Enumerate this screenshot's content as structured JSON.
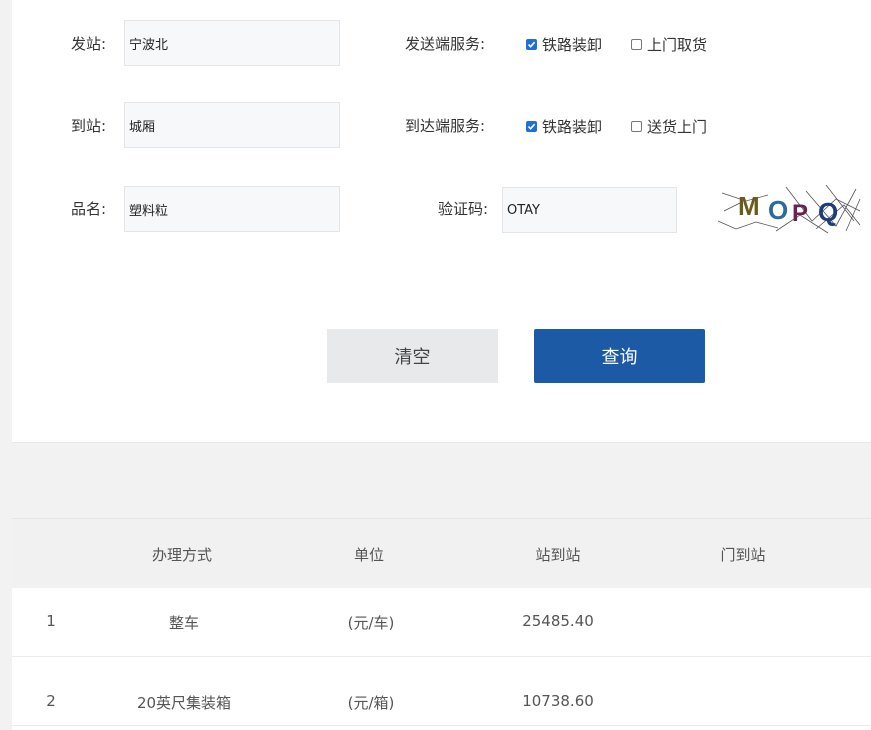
{
  "form": {
    "origin_label": "发站:",
    "origin_value": "宁波北",
    "dest_label": "到站:",
    "dest_value": "城厢",
    "goods_label": "品名:",
    "goods_value": "塑料粒",
    "send_service_label": "发送端服务:",
    "send_rail_label": "铁路装卸",
    "send_rail_checked": true,
    "send_pickup_label": "上门取货",
    "send_pickup_checked": false,
    "arrive_service_label": "到达端服务:",
    "arrive_rail_label": "铁路装卸",
    "arrive_rail_checked": true,
    "arrive_delivery_label": "送货上门",
    "arrive_delivery_checked": false,
    "captcha_label": "验证码:",
    "captcha_value": "OTAY",
    "captcha_image_text": "MOPQ"
  },
  "buttons": {
    "clear_label": "清空",
    "query_label": "查询"
  },
  "table": {
    "headers": [
      "办理方式",
      "单位",
      "站到站",
      "门到站"
    ],
    "rows": [
      {
        "index": "1",
        "method": "整车",
        "unit": "(元/车)",
        "station_to_station": "25485.40",
        "door_to_station": ""
      },
      {
        "index": "2",
        "method": "20英尺集装箱",
        "unit": "(元/箱)",
        "station_to_station": "10738.60",
        "door_to_station": ""
      }
    ]
  },
  "colors": {
    "primary_button": "#1d5aa6",
    "checkbox_checked": "#1f6fd6",
    "input_background": "#f7f8fa"
  }
}
